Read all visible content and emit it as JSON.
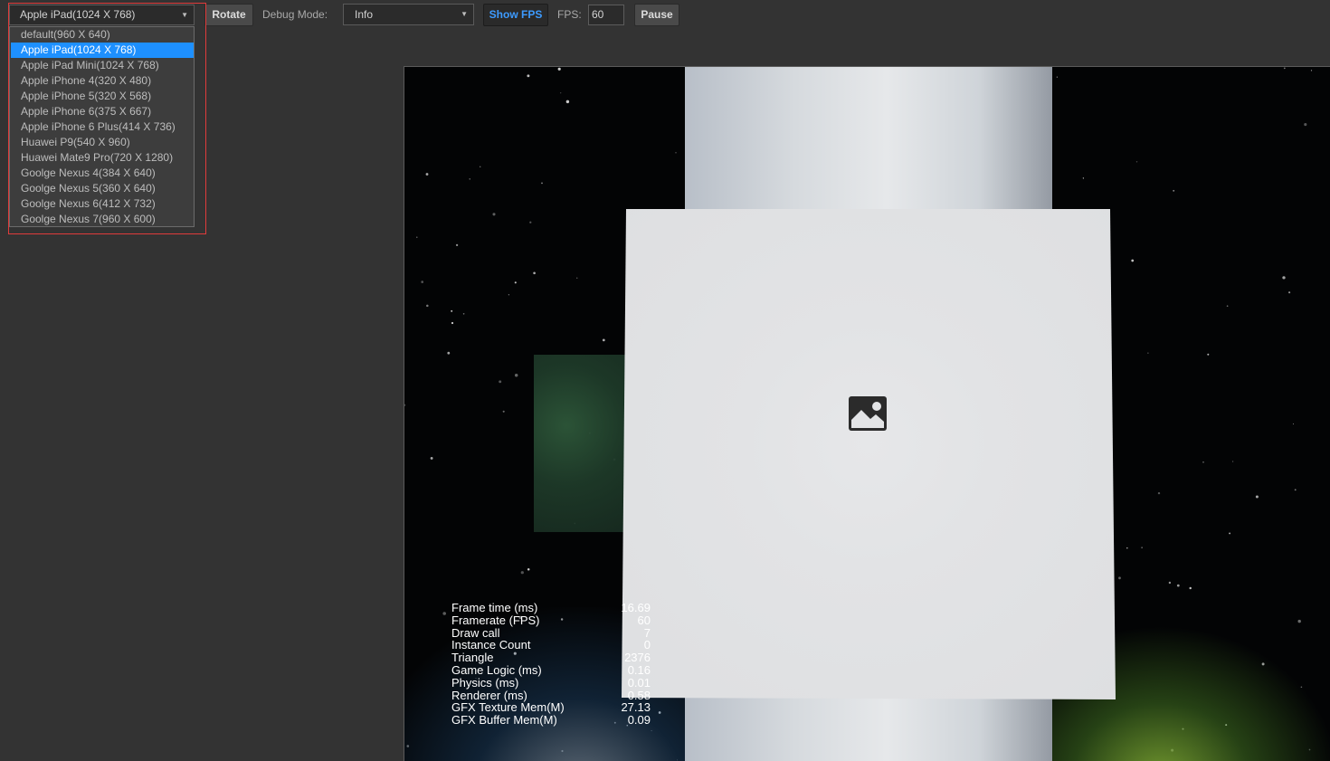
{
  "toolbar": {
    "device_select_value": "Apple iPad(1024 X 768)",
    "rotate_label": "Rotate",
    "debug_mode_label": "Debug Mode:",
    "debug_mode_value": "Info",
    "show_fps_label": "Show FPS",
    "fps_label": "FPS:",
    "fps_value": "60",
    "pause_label": "Pause",
    "dropdown_arrow_icon": "triangle-down-icon"
  },
  "device_dropdown": {
    "items": [
      {
        "label": "default(960 X 640)"
      },
      {
        "label": "Apple iPad(1024 X 768)",
        "selected": true
      },
      {
        "label": "Apple iPad Mini(1024 X 768)"
      },
      {
        "label": "Apple iPhone 4(320 X 480)"
      },
      {
        "label": "Apple iPhone 5(320 X 568)"
      },
      {
        "label": "Apple iPhone 6(375 X 667)"
      },
      {
        "label": "Apple iPhone 6 Plus(414 X 736)"
      },
      {
        "label": "Huawei P9(540 X 960)"
      },
      {
        "label": "Huawei Mate9 Pro(720 X 1280)"
      },
      {
        "label": "Goolge Nexus 4(384 X 640)"
      },
      {
        "label": "Goolge Nexus 5(360 X 640)"
      },
      {
        "label": "Goolge Nexus 6(412 X 732)"
      },
      {
        "label": "Goolge Nexus 7(960 X 600)"
      }
    ]
  },
  "scene": {
    "placeholder_icon": "image-placeholder-icon"
  },
  "stats": {
    "rows": [
      {
        "label": "Frame time (ms)",
        "value": "16.69"
      },
      {
        "label": "Framerate (FPS)",
        "value": "60"
      },
      {
        "label": "Draw call",
        "value": "7"
      },
      {
        "label": "Instance Count",
        "value": "0"
      },
      {
        "label": "Triangle",
        "value": "2376"
      },
      {
        "label": "Game Logic (ms)",
        "value": "0.16"
      },
      {
        "label": "Physics (ms)",
        "value": "0.01"
      },
      {
        "label": "Renderer (ms)",
        "value": "0.58"
      },
      {
        "label": "GFX Texture Mem(M)",
        "value": "27.13"
      },
      {
        "label": "GFX Buffer Mem(M)",
        "value": "0.09"
      }
    ]
  },
  "colors": {
    "background": "#333333",
    "selection": "#1e90ff",
    "active_button_text": "#3d9bff",
    "focus_outline": "#e03b3b"
  }
}
